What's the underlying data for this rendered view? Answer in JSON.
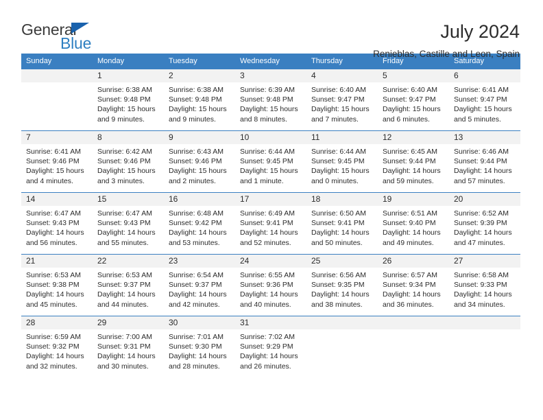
{
  "brand": {
    "name_dark": "General",
    "name_blue": "Blue",
    "accent_color": "#2e7fc1",
    "triangle_color": "#1a62ad"
  },
  "header": {
    "title": "July 2024",
    "subtitle": "Renieblas, Castille and Leon, Spain"
  },
  "calendar": {
    "header_bg": "#3a7fc1",
    "header_text_color": "#ffffff",
    "daynum_bg": "#f2f2f2",
    "weekday_headers": [
      "Sunday",
      "Monday",
      "Tuesday",
      "Wednesday",
      "Thursday",
      "Friday",
      "Saturday"
    ],
    "weeks": [
      [
        {
          "day": "",
          "sunrise": "",
          "sunset": "",
          "daylight_line1": "",
          "daylight_line2": "",
          "empty": true
        },
        {
          "day": "1",
          "sunrise": "Sunrise: 6:38 AM",
          "sunset": "Sunset: 9:48 PM",
          "daylight_line1": "Daylight: 15 hours",
          "daylight_line2": "and 9 minutes."
        },
        {
          "day": "2",
          "sunrise": "Sunrise: 6:38 AM",
          "sunset": "Sunset: 9:48 PM",
          "daylight_line1": "Daylight: 15 hours",
          "daylight_line2": "and 9 minutes."
        },
        {
          "day": "3",
          "sunrise": "Sunrise: 6:39 AM",
          "sunset": "Sunset: 9:48 PM",
          "daylight_line1": "Daylight: 15 hours",
          "daylight_line2": "and 8 minutes."
        },
        {
          "day": "4",
          "sunrise": "Sunrise: 6:40 AM",
          "sunset": "Sunset: 9:47 PM",
          "daylight_line1": "Daylight: 15 hours",
          "daylight_line2": "and 7 minutes."
        },
        {
          "day": "5",
          "sunrise": "Sunrise: 6:40 AM",
          "sunset": "Sunset: 9:47 PM",
          "daylight_line1": "Daylight: 15 hours",
          "daylight_line2": "and 6 minutes."
        },
        {
          "day": "6",
          "sunrise": "Sunrise: 6:41 AM",
          "sunset": "Sunset: 9:47 PM",
          "daylight_line1": "Daylight: 15 hours",
          "daylight_line2": "and 5 minutes."
        }
      ],
      [
        {
          "day": "7",
          "sunrise": "Sunrise: 6:41 AM",
          "sunset": "Sunset: 9:46 PM",
          "daylight_line1": "Daylight: 15 hours",
          "daylight_line2": "and 4 minutes."
        },
        {
          "day": "8",
          "sunrise": "Sunrise: 6:42 AM",
          "sunset": "Sunset: 9:46 PM",
          "daylight_line1": "Daylight: 15 hours",
          "daylight_line2": "and 3 minutes."
        },
        {
          "day": "9",
          "sunrise": "Sunrise: 6:43 AM",
          "sunset": "Sunset: 9:46 PM",
          "daylight_line1": "Daylight: 15 hours",
          "daylight_line2": "and 2 minutes."
        },
        {
          "day": "10",
          "sunrise": "Sunrise: 6:44 AM",
          "sunset": "Sunset: 9:45 PM",
          "daylight_line1": "Daylight: 15 hours",
          "daylight_line2": "and 1 minute."
        },
        {
          "day": "11",
          "sunrise": "Sunrise: 6:44 AM",
          "sunset": "Sunset: 9:45 PM",
          "daylight_line1": "Daylight: 15 hours",
          "daylight_line2": "and 0 minutes."
        },
        {
          "day": "12",
          "sunrise": "Sunrise: 6:45 AM",
          "sunset": "Sunset: 9:44 PM",
          "daylight_line1": "Daylight: 14 hours",
          "daylight_line2": "and 59 minutes."
        },
        {
          "day": "13",
          "sunrise": "Sunrise: 6:46 AM",
          "sunset": "Sunset: 9:44 PM",
          "daylight_line1": "Daylight: 14 hours",
          "daylight_line2": "and 57 minutes."
        }
      ],
      [
        {
          "day": "14",
          "sunrise": "Sunrise: 6:47 AM",
          "sunset": "Sunset: 9:43 PM",
          "daylight_line1": "Daylight: 14 hours",
          "daylight_line2": "and 56 minutes."
        },
        {
          "day": "15",
          "sunrise": "Sunrise: 6:47 AM",
          "sunset": "Sunset: 9:43 PM",
          "daylight_line1": "Daylight: 14 hours",
          "daylight_line2": "and 55 minutes."
        },
        {
          "day": "16",
          "sunrise": "Sunrise: 6:48 AM",
          "sunset": "Sunset: 9:42 PM",
          "daylight_line1": "Daylight: 14 hours",
          "daylight_line2": "and 53 minutes."
        },
        {
          "day": "17",
          "sunrise": "Sunrise: 6:49 AM",
          "sunset": "Sunset: 9:41 PM",
          "daylight_line1": "Daylight: 14 hours",
          "daylight_line2": "and 52 minutes."
        },
        {
          "day": "18",
          "sunrise": "Sunrise: 6:50 AM",
          "sunset": "Sunset: 9:41 PM",
          "daylight_line1": "Daylight: 14 hours",
          "daylight_line2": "and 50 minutes."
        },
        {
          "day": "19",
          "sunrise": "Sunrise: 6:51 AM",
          "sunset": "Sunset: 9:40 PM",
          "daylight_line1": "Daylight: 14 hours",
          "daylight_line2": "and 49 minutes."
        },
        {
          "day": "20",
          "sunrise": "Sunrise: 6:52 AM",
          "sunset": "Sunset: 9:39 PM",
          "daylight_line1": "Daylight: 14 hours",
          "daylight_line2": "and 47 minutes."
        }
      ],
      [
        {
          "day": "21",
          "sunrise": "Sunrise: 6:53 AM",
          "sunset": "Sunset: 9:38 PM",
          "daylight_line1": "Daylight: 14 hours",
          "daylight_line2": "and 45 minutes."
        },
        {
          "day": "22",
          "sunrise": "Sunrise: 6:53 AM",
          "sunset": "Sunset: 9:37 PM",
          "daylight_line1": "Daylight: 14 hours",
          "daylight_line2": "and 44 minutes."
        },
        {
          "day": "23",
          "sunrise": "Sunrise: 6:54 AM",
          "sunset": "Sunset: 9:37 PM",
          "daylight_line1": "Daylight: 14 hours",
          "daylight_line2": "and 42 minutes."
        },
        {
          "day": "24",
          "sunrise": "Sunrise: 6:55 AM",
          "sunset": "Sunset: 9:36 PM",
          "daylight_line1": "Daylight: 14 hours",
          "daylight_line2": "and 40 minutes."
        },
        {
          "day": "25",
          "sunrise": "Sunrise: 6:56 AM",
          "sunset": "Sunset: 9:35 PM",
          "daylight_line1": "Daylight: 14 hours",
          "daylight_line2": "and 38 minutes."
        },
        {
          "day": "26",
          "sunrise": "Sunrise: 6:57 AM",
          "sunset": "Sunset: 9:34 PM",
          "daylight_line1": "Daylight: 14 hours",
          "daylight_line2": "and 36 minutes."
        },
        {
          "day": "27",
          "sunrise": "Sunrise: 6:58 AM",
          "sunset": "Sunset: 9:33 PM",
          "daylight_line1": "Daylight: 14 hours",
          "daylight_line2": "and 34 minutes."
        }
      ],
      [
        {
          "day": "28",
          "sunrise": "Sunrise: 6:59 AM",
          "sunset": "Sunset: 9:32 PM",
          "daylight_line1": "Daylight: 14 hours",
          "daylight_line2": "and 32 minutes."
        },
        {
          "day": "29",
          "sunrise": "Sunrise: 7:00 AM",
          "sunset": "Sunset: 9:31 PM",
          "daylight_line1": "Daylight: 14 hours",
          "daylight_line2": "and 30 minutes."
        },
        {
          "day": "30",
          "sunrise": "Sunrise: 7:01 AM",
          "sunset": "Sunset: 9:30 PM",
          "daylight_line1": "Daylight: 14 hours",
          "daylight_line2": "and 28 minutes."
        },
        {
          "day": "31",
          "sunrise": "Sunrise: 7:02 AM",
          "sunset": "Sunset: 9:29 PM",
          "daylight_line1": "Daylight: 14 hours",
          "daylight_line2": "and 26 minutes."
        },
        {
          "day": "",
          "sunrise": "",
          "sunset": "",
          "daylight_line1": "",
          "daylight_line2": "",
          "empty": true
        },
        {
          "day": "",
          "sunrise": "",
          "sunset": "",
          "daylight_line1": "",
          "daylight_line2": "",
          "empty": true
        },
        {
          "day": "",
          "sunrise": "",
          "sunset": "",
          "daylight_line1": "",
          "daylight_line2": "",
          "empty": true
        }
      ]
    ]
  }
}
